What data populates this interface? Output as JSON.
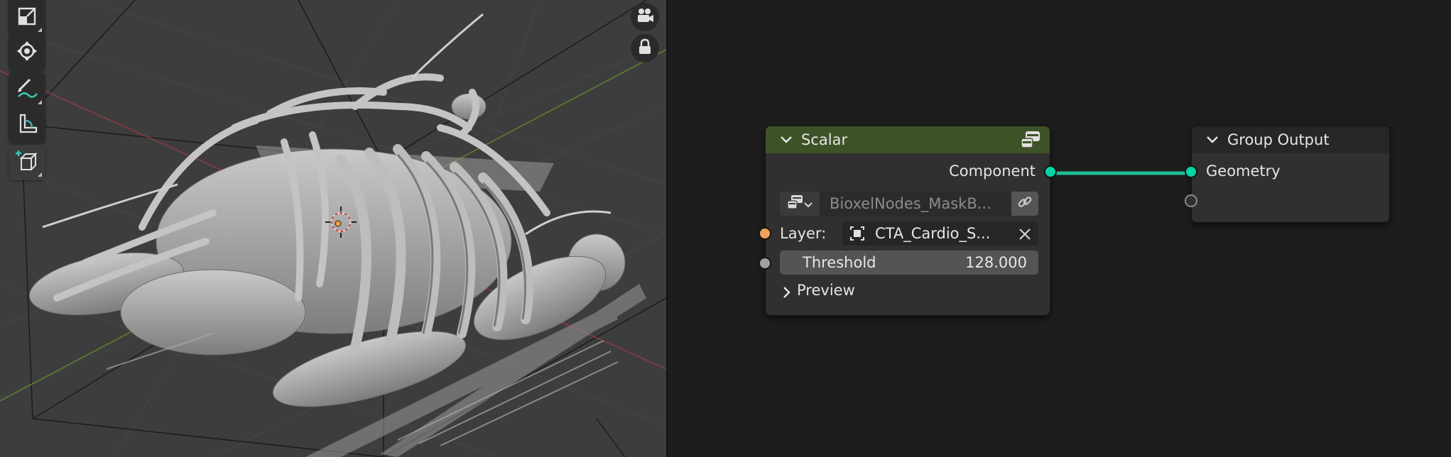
{
  "viewport": {
    "tools": [
      {
        "icon": "scale-icon"
      },
      {
        "icon": "transform-icon"
      },
      {
        "icon": "annotate-icon"
      },
      {
        "icon": "measure-icon"
      },
      {
        "icon": "add-cube-icon"
      }
    ],
    "nav": [
      {
        "icon": "camera-view-icon"
      },
      {
        "icon": "lock-icon"
      }
    ]
  },
  "nodes": {
    "scalar": {
      "title": "Scalar",
      "header_color": "#3e5227",
      "output_label": "Component",
      "object_field_value": "BioxelNodes_MaskB...",
      "layer_label": "Layer:",
      "layer_value": "CTA_Cardio_S...",
      "threshold_label": "Threshold",
      "threshold_value": "128.000",
      "preview_label": "Preview"
    },
    "group_output": {
      "title": "Group Output",
      "header_color": "#262626",
      "input_label": "Geometry"
    }
  },
  "colors": {
    "geometry_socket": "#00d6a3",
    "layer_socket": "#f2a15a",
    "float_socket": "#a1a1a1",
    "link": "#1fbf97"
  }
}
